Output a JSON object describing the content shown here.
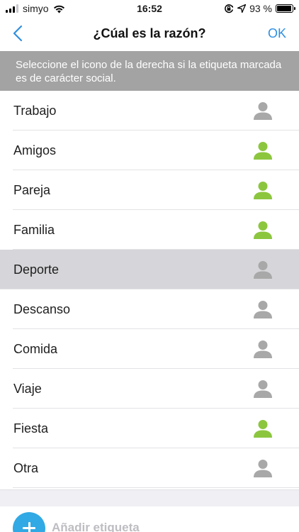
{
  "status_bar": {
    "carrier": "simyo",
    "time": "16:52",
    "battery": "93 %",
    "battery_level": 0.93,
    "icons": [
      "cellular-signal-icon",
      "wifi-icon",
      "orientation-lock-icon",
      "location-arrow-icon",
      "battery-icon"
    ]
  },
  "nav": {
    "title": "¿Cúal es la razón?",
    "ok_label": "OK",
    "back_icon": "chevron-left-icon",
    "accent_color": "#2f8fe0"
  },
  "banner": {
    "text": "Seleccione el icono de la derecha si la etiqueta marcada es de carácter social."
  },
  "colors": {
    "social_active": "#8cc63f",
    "social_inactive": "#a8a8a8",
    "selected_row": "#d6d6da"
  },
  "tags": [
    {
      "label": "Trabajo",
      "social": false,
      "selected": false
    },
    {
      "label": "Amigos",
      "social": true,
      "selected": false
    },
    {
      "label": "Pareja",
      "social": true,
      "selected": false
    },
    {
      "label": "Familia",
      "social": true,
      "selected": false
    },
    {
      "label": "Deporte",
      "social": false,
      "selected": true
    },
    {
      "label": "Descanso",
      "social": false,
      "selected": false
    },
    {
      "label": "Comida",
      "social": false,
      "selected": false
    },
    {
      "label": "Viaje",
      "social": false,
      "selected": false
    },
    {
      "label": "Fiesta",
      "social": true,
      "selected": false
    },
    {
      "label": "Otra",
      "social": false,
      "selected": false
    }
  ],
  "add_tag": {
    "label": "Añadir etiqueta",
    "icon": "plus-icon"
  }
}
